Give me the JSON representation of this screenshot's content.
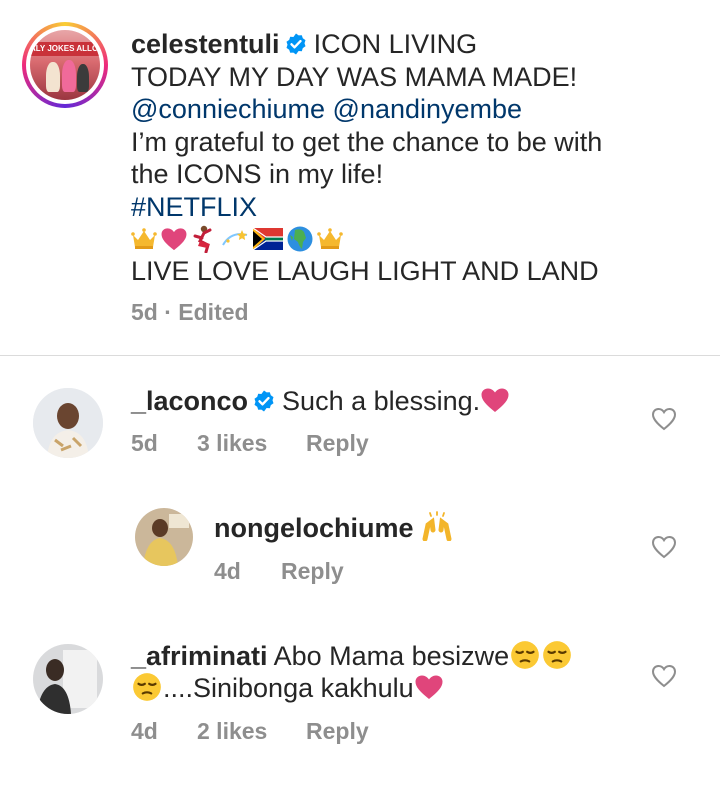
{
  "post": {
    "username": "celestentuli",
    "avatar_banner": "ALY JOKES ALLOWED",
    "lines": {
      "line1": "ICON LIVING",
      "line2": "TODAY MY DAY WAS MAMA MADE!",
      "mention1": "@conniechiume",
      "mention2": "@nandinyembe",
      "line4a": "I’m grateful to get the chance to be with",
      "line4b": "the ICONS in my life!",
      "hashtag": "#NETFLIX",
      "line7": "LIVE LOVE LAUGH LIGHT AND LAND"
    },
    "emojis": [
      "crown-emoji",
      "pink-heart-emoji",
      "dancer-emoji",
      "dizzy-emoji",
      "south-africa-flag-emoji",
      "globe-africa-emoji",
      "crown-emoji"
    ],
    "time": "5d",
    "separator": "·",
    "edited": "Edited"
  },
  "comments": [
    {
      "username": "_laconco",
      "verified": true,
      "text": "Such a blessing.",
      "trailing_emoji": "pink-heart-emoji",
      "time": "5d",
      "likes": "3 likes",
      "reply": "Reply"
    },
    {
      "username": "nongelochiume",
      "verified": false,
      "text": "",
      "trailing_emoji": "raising-hands-emoji",
      "time": "4d",
      "likes": "",
      "reply": "Reply"
    },
    {
      "username": "_afriminati",
      "verified": false,
      "text_a": "Abo Mama besizwe",
      "text_b": "....Sinibonga kakhulu",
      "emojis": [
        "pensive-face-emoji",
        "pensive-face-emoji",
        "pensive-face-emoji",
        "pink-heart-emoji"
      ],
      "time": "4d",
      "likes": "2 likes",
      "reply": "Reply"
    }
  ],
  "colors": {
    "link": "#00376b",
    "verified": "#0095f6",
    "meta": "#8e8e8e",
    "heart": "#e0457b"
  }
}
